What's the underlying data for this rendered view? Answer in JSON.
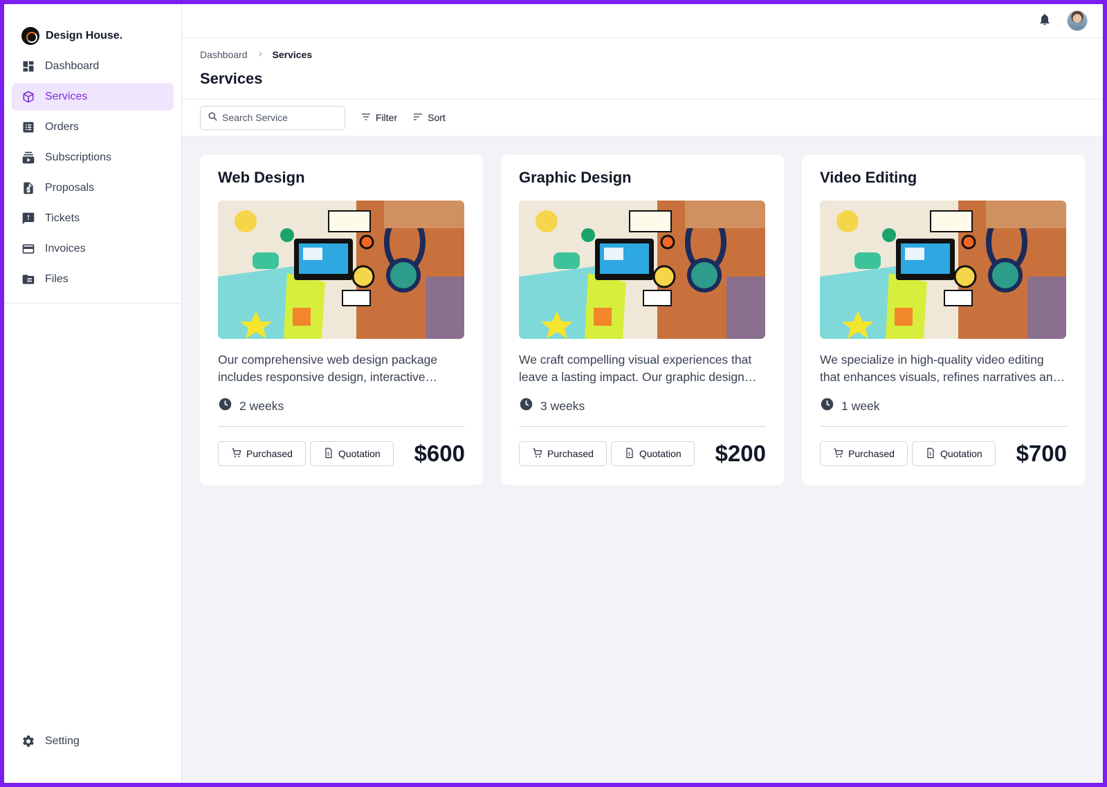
{
  "brand": {
    "name": "Design House."
  },
  "sidebar": {
    "items": [
      {
        "label": "Dashboard",
        "icon": "dashboard-icon",
        "active": false
      },
      {
        "label": "Services",
        "icon": "box-icon",
        "active": true
      },
      {
        "label": "Orders",
        "icon": "list-icon",
        "active": false
      },
      {
        "label": "Subscriptions",
        "icon": "subscriptions-icon",
        "active": false
      },
      {
        "label": "Proposals",
        "icon": "dollar-file-icon",
        "active": false
      },
      {
        "label": "Tickets",
        "icon": "feedback-icon",
        "active": false
      },
      {
        "label": "Invoices",
        "icon": "card-icon",
        "active": false
      },
      {
        "label": "Files",
        "icon": "folder-icon",
        "active": false
      }
    ],
    "setting_label": "Setting"
  },
  "topbar": {
    "notification_icon": "bell-icon",
    "avatar": "user-avatar"
  },
  "breadcrumb": {
    "root": "Dashboard",
    "current": "Services"
  },
  "page": {
    "title": "Services"
  },
  "toolbar": {
    "search_placeholder": "Search Service",
    "filter_label": "Filter",
    "sort_label": "Sort"
  },
  "cards": [
    {
      "title": "Web Design",
      "description": "Our comprehensive web design package includes responsive design, interactive elements and more.",
      "duration": "2 weeks",
      "purchased_label": "Purchased",
      "quotation_label": "Quotation",
      "price": "$600"
    },
    {
      "title": "Graphic Design",
      "description": "We craft compelling visual experiences that leave a lasting impact. Our graphic design team delivers.",
      "duration": "3 weeks",
      "purchased_label": "Purchased",
      "quotation_label": "Quotation",
      "price": "$200"
    },
    {
      "title": "Video Editing",
      "description": "We specialize in high-quality video editing that enhances visuals, refines narratives and more.",
      "duration": "1 week",
      "purchased_label": "Purchased",
      "quotation_label": "Quotation",
      "price": "$700"
    }
  ],
  "colors": {
    "accent": "#7c2fd8",
    "accent_bg": "#efe5fd",
    "frame": "#7a1ff0",
    "canvas": "#f2f3f7"
  }
}
